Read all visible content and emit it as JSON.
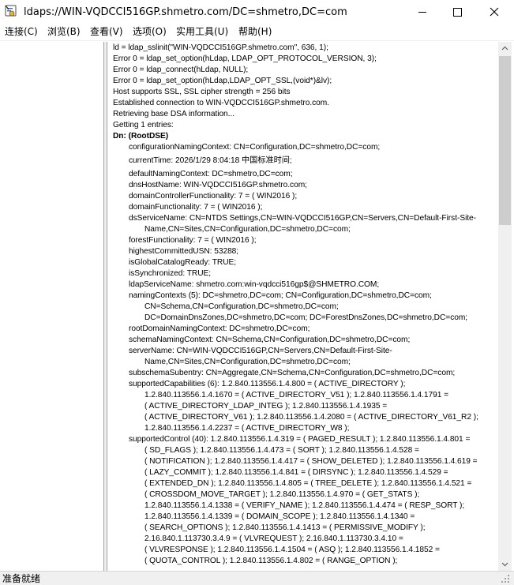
{
  "window": {
    "title": "ldaps://WIN-VQDCCI516GP.shmetro.com/DC=shmetro,DC=com",
    "app_icon": "ldp-app-icon",
    "controls": [
      "minimize-icon",
      "maximize-icon",
      "close-icon"
    ]
  },
  "menu": [
    {
      "label": "连接(C)"
    },
    {
      "label": "浏览(B)"
    },
    {
      "label": "查看(V)"
    },
    {
      "label": "选项(O)"
    },
    {
      "label": "实用工具(U)"
    },
    {
      "label": "帮助(H)"
    }
  ],
  "log": {
    "lines": [
      "ld = ldap_sslinit(\"WIN-VQDCCI516GP.shmetro.com\", 636, 1);",
      "Error 0 = ldap_set_option(hLdap, LDAP_OPT_PROTOCOL_VERSION, 3);",
      "Error 0 = ldap_connect(hLdap, NULL);",
      "Error 0 = ldap_set_option(hLdap,LDAP_OPT_SSL,(void*)&lv);",
      "Host supports SSL, SSL cipher strength = 256 bits",
      "Established connection to WIN-VQDCCI516GP.shmetro.com.",
      "Retrieving base DSA information...",
      "Getting 1 entries:"
    ],
    "dn": "Dn: (RootDSE)",
    "attrs": [
      "configurationNamingContext: CN=Configuration,DC=shmetro,DC=com;",
      "currentTime: 2026/1/29 8:04:18 中国标准时间;",
      "defaultNamingContext: DC=shmetro,DC=com;",
      "dnsHostName: WIN-VQDCCI516GP.shmetro.com;",
      "domainControllerFunctionality: 7 = ( WIN2016 );",
      "domainFunctionality: 7 = ( WIN2016 );",
      "dsServiceName: CN=NTDS Settings,CN=WIN-VQDCCI516GP,CN=Servers,CN=Default-First-Site-",
      "Name,CN=Sites,CN=Configuration,DC=shmetro,DC=com;",
      "forestFunctionality: 7 = ( WIN2016 );",
      "highestCommittedUSN: 53288;",
      "isGlobalCatalogReady: TRUE;",
      "isSynchronized: TRUE;",
      "ldapServiceName: shmetro.com:win-vqdcci516gp$@SHMETRO.COM;",
      "namingContexts (5): DC=shmetro,DC=com; CN=Configuration,DC=shmetro,DC=com;",
      "CN=Schema,CN=Configuration,DC=shmetro,DC=com;",
      "DC=DomainDnsZones,DC=shmetro,DC=com; DC=ForestDnsZones,DC=shmetro,DC=com;",
      "rootDomainNamingContext: DC=shmetro,DC=com;",
      "schemaNamingContext: CN=Schema,CN=Configuration,DC=shmetro,DC=com;",
      "serverName: CN=WIN-VQDCCI516GP,CN=Servers,CN=Default-First-Site-",
      "Name,CN=Sites,CN=Configuration,DC=shmetro,DC=com;",
      "subschemaSubentry: CN=Aggregate,CN=Schema,CN=Configuration,DC=shmetro,DC=com;",
      "supportedCapabilities (6): 1.2.840.113556.1.4.800 = ( ACTIVE_DIRECTORY );",
      "1.2.840.113556.1.4.1670 = ( ACTIVE_DIRECTORY_V51 ); 1.2.840.113556.1.4.1791 =",
      "( ACTIVE_DIRECTORY_LDAP_INTEG ); 1.2.840.113556.1.4.1935 =",
      "( ACTIVE_DIRECTORY_V61 ); 1.2.840.113556.1.4.2080 = ( ACTIVE_DIRECTORY_V61_R2 );",
      "1.2.840.113556.1.4.2237 = ( ACTIVE_DIRECTORY_W8 );",
      "supportedControl (40): 1.2.840.113556.1.4.319 = ( PAGED_RESULT ); 1.2.840.113556.1.4.801 =",
      "( SD_FLAGS ); 1.2.840.113556.1.4.473 = ( SORT ); 1.2.840.113556.1.4.528 =",
      "( NOTIFICATION ); 1.2.840.113556.1.4.417 = ( SHOW_DELETED ); 1.2.840.113556.1.4.619 =",
      "( LAZY_COMMIT ); 1.2.840.113556.1.4.841 = ( DIRSYNC ); 1.2.840.113556.1.4.529 =",
      "( EXTENDED_DN ); 1.2.840.113556.1.4.805 = ( TREE_DELETE ); 1.2.840.113556.1.4.521 =",
      "( CROSSDOM_MOVE_TARGET ); 1.2.840.113556.1.4.970 = ( GET_STATS );",
      "1.2.840.113556.1.4.1338 = ( VERIFY_NAME ); 1.2.840.113556.1.4.474 = ( RESP_SORT );",
      "1.2.840.113556.1.4.1339 = ( DOMAIN_SCOPE ); 1.2.840.113556.1.4.1340 =",
      "( SEARCH_OPTIONS ); 1.2.840.113556.1.4.1413 = ( PERMISSIVE_MODIFY );",
      "2.16.840.1.113730.3.4.9 = ( VLVREQUEST ); 2.16.840.1.113730.3.4.10 =",
      "( VLVRESPONSE ); 1.2.840.113556.1.4.1504 = ( ASQ ); 1.2.840.113556.1.4.1852 =",
      "( QUOTA_CONTROL ); 1.2.840.113556.1.4.802 = ( RANGE_OPTION );"
    ]
  },
  "status": {
    "text": "准备就绪"
  }
}
